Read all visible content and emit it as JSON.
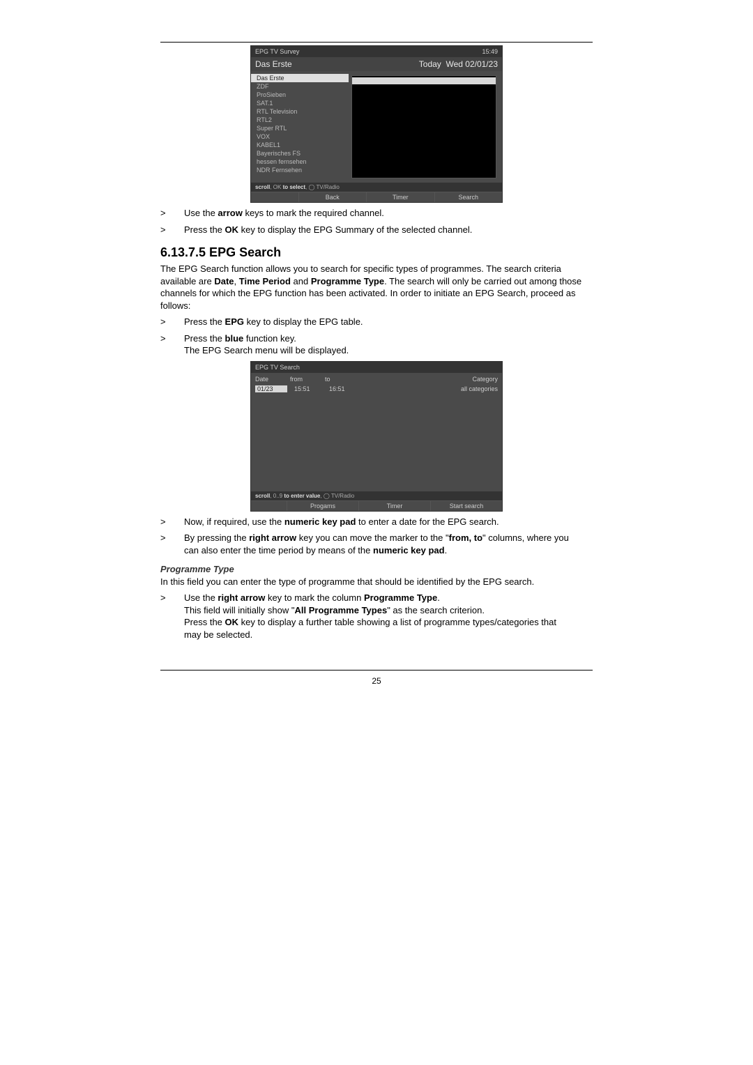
{
  "page_number": "25",
  "fig1": {
    "title": "EPG TV Survey",
    "time": "15:49",
    "channel": "Das Erste",
    "today": "Today",
    "date": "Wed 02/01/23",
    "channels": [
      "Das Erste",
      "ZDF",
      "ProSieben",
      "SAT.1",
      "RTL Television",
      "RTL2",
      "Super RTL",
      "VOX",
      "KABEL1",
      "Bayerisches FS",
      "hessen fernsehen",
      "NDR Fernsehen"
    ],
    "hint": "scroll, OK to select, ◯ TV/Radio",
    "btn1": "Back",
    "btn2": "Timer",
    "btn3": "Search"
  },
  "instr1": {
    "gt": ">",
    "text_a": "Use the ",
    "b1": "arrow",
    "text_b": " keys to mark the required channel."
  },
  "instr2": {
    "gt": ">",
    "text_a": "Press the ",
    "b1": "OK",
    "text_b": " key to display the EPG Summary of the selected channel."
  },
  "section_heading": "6.13.7.5 EPG Search",
  "para1_a": "The EPG Search function allows you to search for specific types of programmes. The search criteria available are ",
  "para1_b1": "Date",
  "para1_c": ", ",
  "para1_b2": "Time Period",
  "para1_d": " and ",
  "para1_b3": "Programme Type",
  "para1_e": ". The search will only be carried out among those channels for which the EPG function has been activated. In order to initiate an EPG Search, proceed as follows:",
  "instr3": {
    "gt": ">",
    "text_a": "Press the ",
    "b1": "EPG",
    "text_b": " key to display the EPG table."
  },
  "instr4": {
    "gt": ">",
    "text_a": "Press the ",
    "b1": "blue",
    "text_b": " function key."
  },
  "instr4b": "The EPG Search menu will be displayed.",
  "fig2": {
    "title": "EPG TV Search",
    "h1": "Date",
    "h2": "from",
    "h3": "to",
    "h4": "Category",
    "v1": "01/23",
    "v2": "15:51",
    "v3": "16:51",
    "v4": "all categories",
    "hint": "scroll, 0..9 to enter value, ◯ TV/Radio",
    "btn1": "Progams",
    "btn2": "Timer",
    "btn3": "Start search"
  },
  "instr5": {
    "gt": ">",
    "a": "Now, if required, use the ",
    "b1": "numeric key pad",
    "c": " to enter a date for the EPG search."
  },
  "instr6": {
    "gt": ">",
    "a": "By pressing the ",
    "b1": "right arrow",
    "c": " key you can move the marker to the \"",
    "b2": "from, to",
    "d": "\" columns, where you can also enter the time period by means of the ",
    "b3": "numeric key pad",
    "e": "."
  },
  "subhead": "Programme Type",
  "para2": "In this field you can enter the type of programme that should be identified by the EPG search.",
  "instr7": {
    "gt": ">",
    "a": "Use the ",
    "b1": "right arrow",
    "c": " key to mark the column ",
    "b2": "Programme Type",
    "d": "."
  },
  "instr7b_a": "This field will initially show \"",
  "instr7b_b": "All Programme Types",
  "instr7b_c": "\" as the search criterion.",
  "instr7c_a": "Press the ",
  "instr7c_b": "OK",
  "instr7c_c": " key to display a further table showing a list of programme types/categories that may be selected."
}
